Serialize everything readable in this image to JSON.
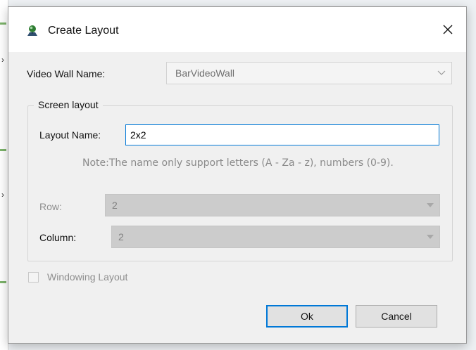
{
  "dialog": {
    "title": "Create Layout",
    "video_wall_label": "Video Wall Name:",
    "video_wall_value": "BarVideoWall",
    "group_title": "Screen layout",
    "layout_name_label": "Layout Name:",
    "layout_name_value": "2x2",
    "note": "Note:The name only support letters (A - Za - z), numbers (0-9).",
    "row_label": "Row:",
    "row_value": "2",
    "column_label": "Column:",
    "column_value": "2",
    "windowing_label": "Windowing Layout",
    "windowing_checked": false,
    "ok_label": "Ok",
    "cancel_label": "Cancel"
  },
  "icons": {
    "title": "create-layout-icon",
    "close": "close-icon",
    "dropdown": "chevron-down-icon"
  },
  "colors": {
    "accent": "#0078d7",
    "disabled_text": "#8e8e8e",
    "disabled_fill": "#cccccc"
  }
}
